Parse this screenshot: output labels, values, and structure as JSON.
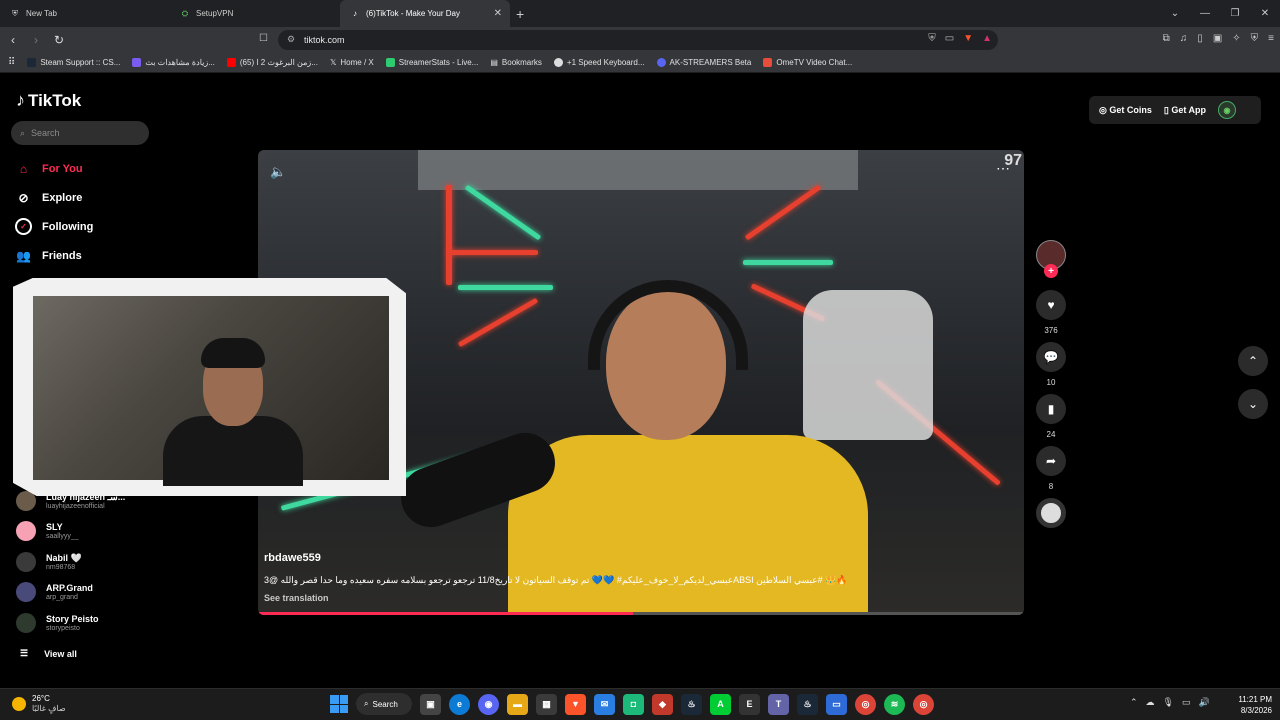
{
  "browser": {
    "tabs": [
      {
        "title": "New Tab",
        "icon": "shield-icon"
      },
      {
        "title": "SetupVPN",
        "icon": "vpn-icon"
      },
      {
        "title": "(6)TikTok - Make Your Day",
        "icon": "tiktok-icon",
        "active": true
      }
    ],
    "url": "tiktok.com",
    "bookmarks": [
      {
        "label": "Steam Support :: CS...",
        "color": "#1b2838"
      },
      {
        "label": "زيادة مشاهدات بث...",
        "color": "#7a5cf0"
      },
      {
        "label": "(65) زمن البرغوث 2 ا...",
        "color": "#ff0000"
      },
      {
        "label": "Home / X",
        "color": "#000000"
      },
      {
        "label": "StreamerStats - Live...",
        "color": "#2ecc71"
      },
      {
        "label": "Bookmarks",
        "color": "#555555"
      },
      {
        "label": "+1 Speed Keyboard...",
        "color": "#222222"
      },
      {
        "label": "AK-STREAMERS Beta",
        "color": "#5865f2"
      },
      {
        "label": "OmeTV Video Chat...",
        "color": "#e74c3c"
      }
    ]
  },
  "tiktok": {
    "logo": "TikTok",
    "search_placeholder": "Search",
    "nav": [
      {
        "label": "For You",
        "icon": "home-icon"
      },
      {
        "label": "Explore",
        "icon": "compass-icon"
      },
      {
        "label": "Following",
        "icon": "following-icon"
      },
      {
        "label": "Friends",
        "icon": "friends-icon"
      }
    ],
    "accounts": [
      {
        "name": "Luay hijazeen سـ...",
        "user": "luayhijazeenofficial",
        "color": "#6b5b4b"
      },
      {
        "name": "SLY",
        "user": "saallyyy__",
        "color": "#f7a1b5"
      },
      {
        "name": "Nabil 🤍",
        "user": "nm98768",
        "color": "#3a3a3a"
      },
      {
        "name": "ARP.Grand",
        "user": "arp_grand",
        "color": "#4a4a7a"
      },
      {
        "name": "Story Peisto",
        "user": "storypeisto",
        "color": "#2f3a2f"
      }
    ],
    "view_all": "View all",
    "get_coins": "Get Coins",
    "get_app": "Get App",
    "video": {
      "corner_count": "97",
      "username": "rbdawe559",
      "caption": "عبسي_لديكم_لا_خوف_عليكم# 💙💙 تم توقف السياتون لا تاريخ11/8 ترجعو ترجعو بسلامه سفره سعيده وما حدا قصر والله",
      "caption_prefix": "@3ABSI عبسي السلاطين# 👑🔥",
      "see_translation": "See translation",
      "progress": 0.49
    },
    "actions": {
      "likes": "376",
      "comments": "10",
      "saves": "24",
      "shares": "8"
    }
  },
  "taskbar": {
    "temp": "26°C",
    "weather": "صافٍ غالبًا",
    "search": "Search",
    "time": "11:21 PM",
    "date": "8/3/2026"
  }
}
